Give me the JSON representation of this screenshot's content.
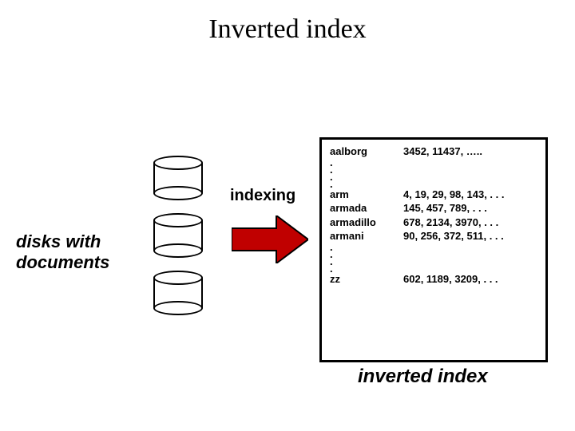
{
  "title": "Inverted index",
  "disks_label": "disks with documents",
  "indexing_label": "indexing",
  "inverted_label": "inverted index",
  "index": {
    "entries_top": [
      {
        "term": "aalborg",
        "postings": "3452,  11437,  ….."
      }
    ],
    "entries_mid": [
      {
        "term": "arm",
        "postings": "4,  19,  29,  98,  143,  . . ."
      },
      {
        "term": "armada",
        "postings": "145,  457,  789,  . . ."
      },
      {
        "term": "armadillo",
        "postings": "678,  2134,  3970,  . . ."
      },
      {
        "term": "armani",
        "postings": "90,  256,  372,  511,  . . ."
      }
    ],
    "entries_bottom": [
      {
        "term": "zz",
        "postings": "602,  1189,  3209,  . . ."
      }
    ]
  }
}
